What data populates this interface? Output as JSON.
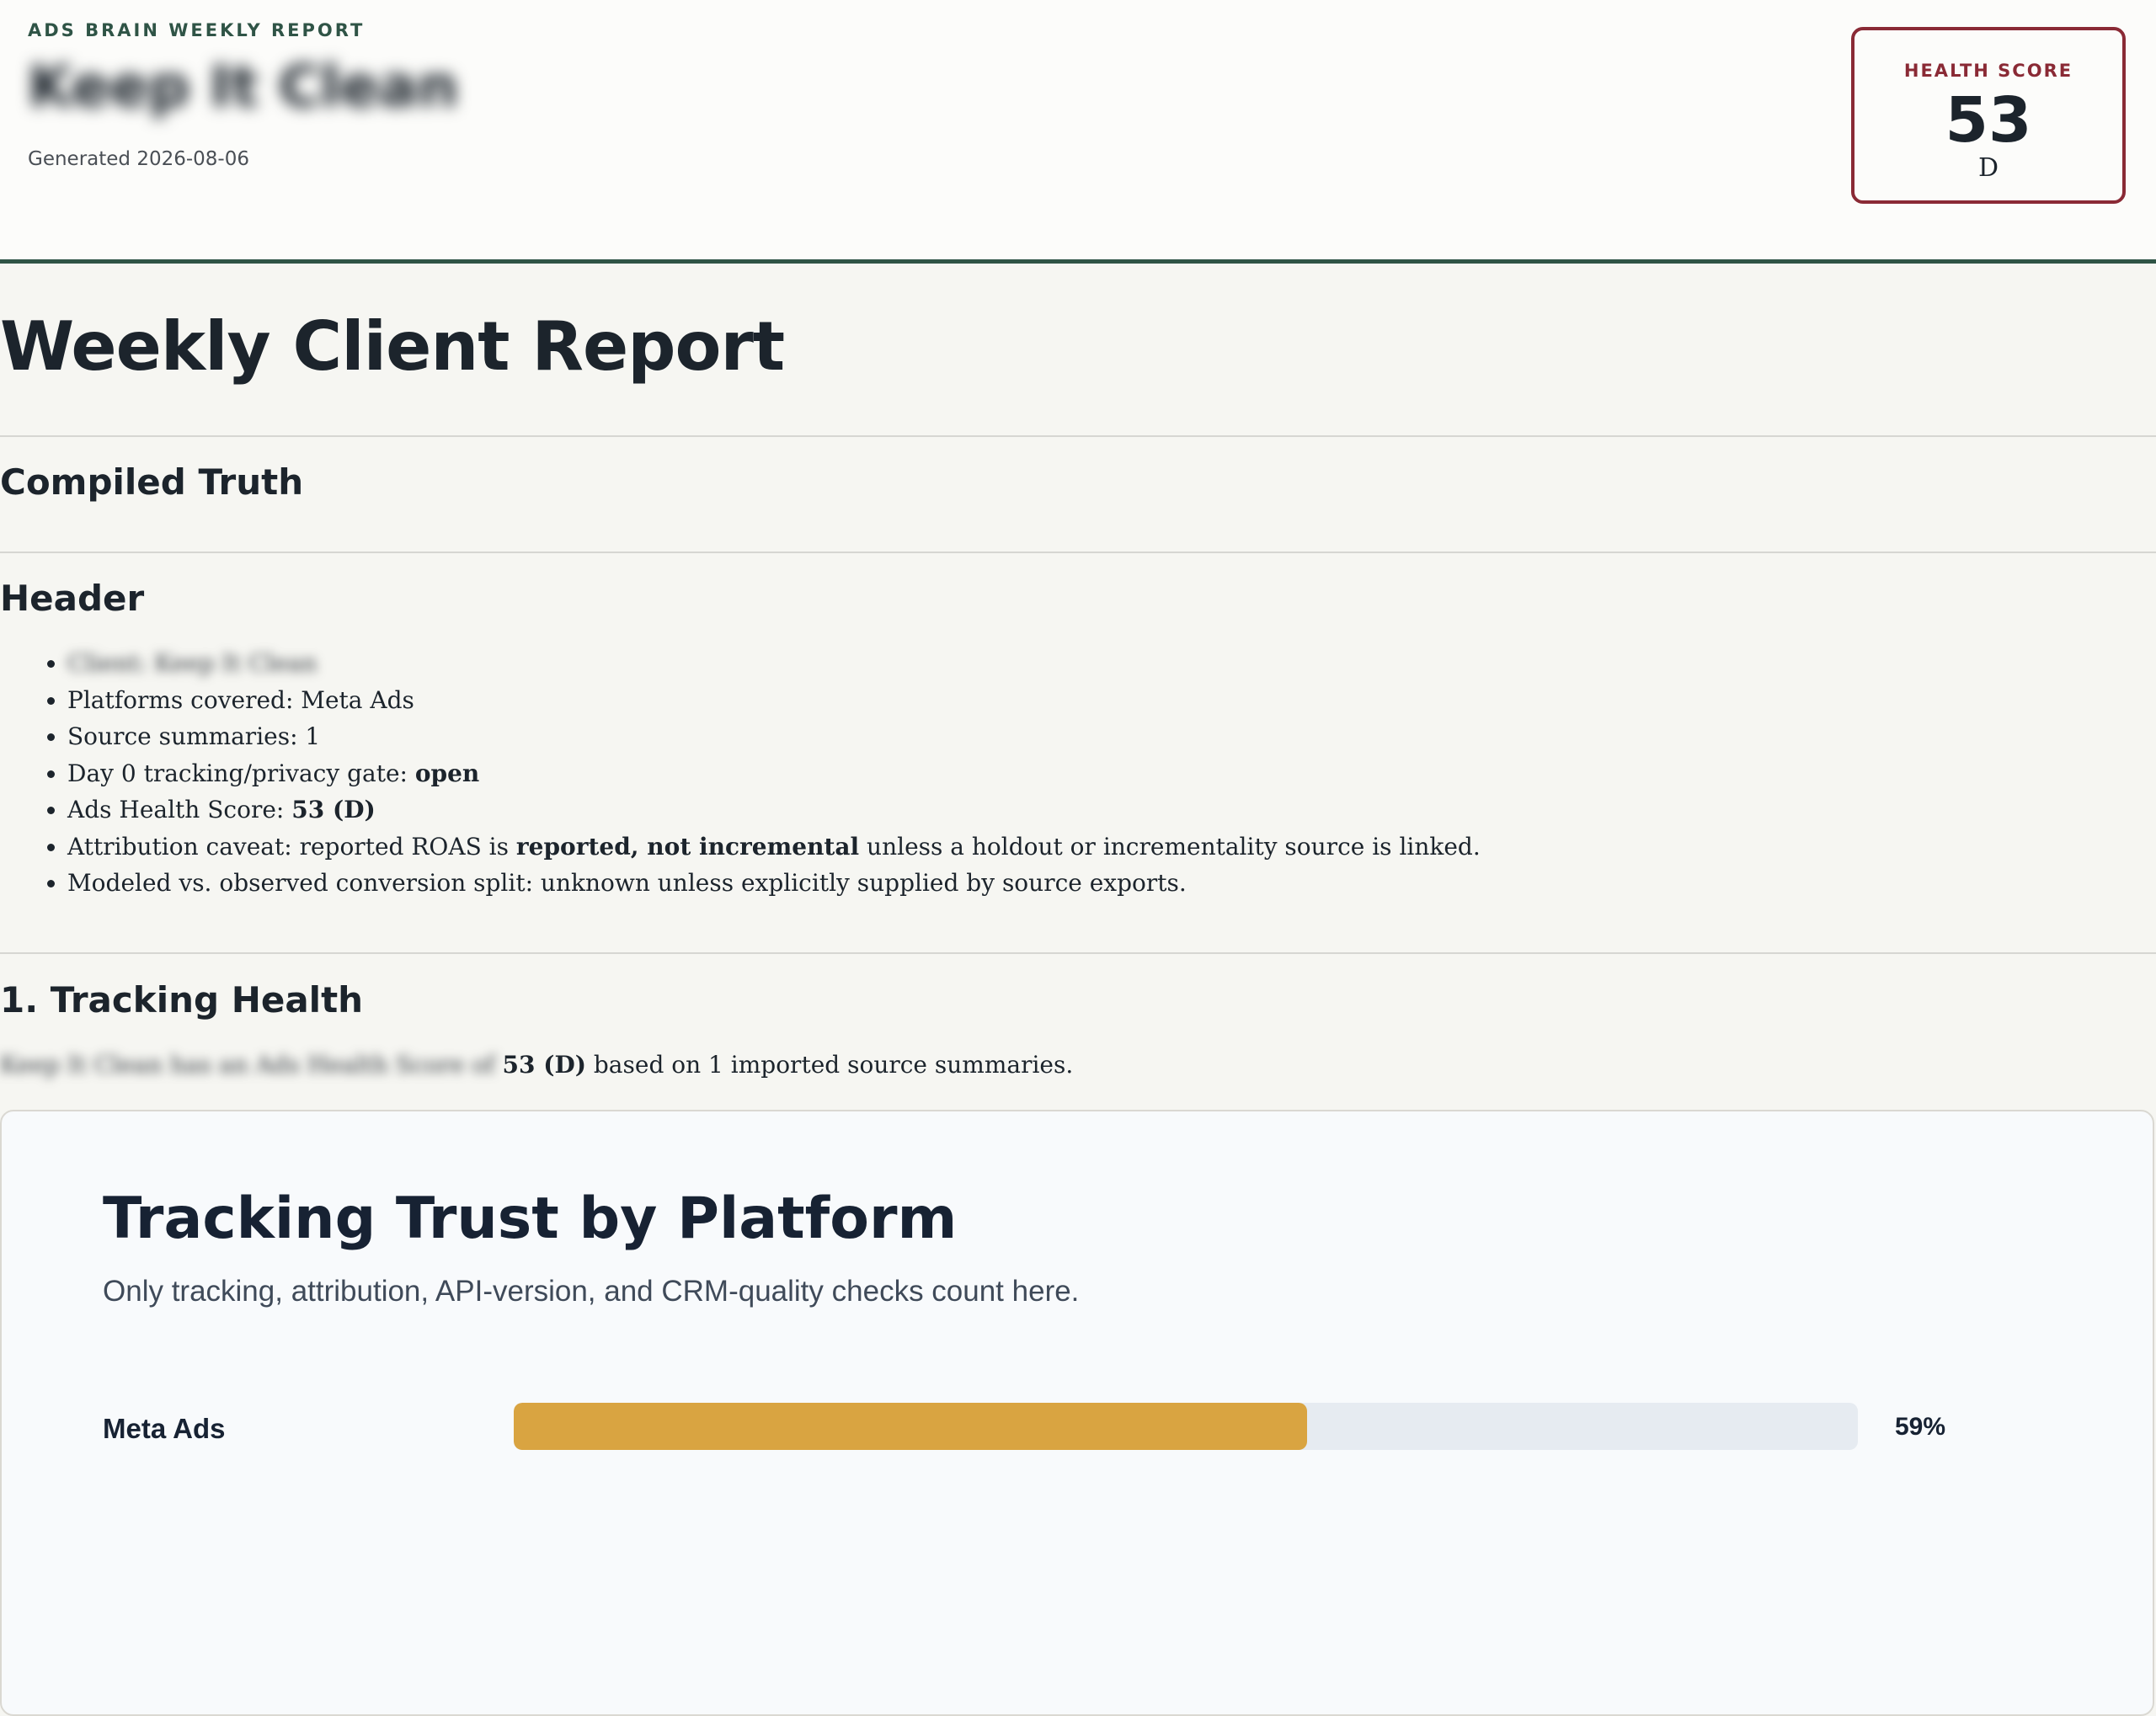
{
  "header": {
    "eyebrow": "ADS BRAIN WEEKLY REPORT",
    "client_name": "Keep It Clean",
    "generated": "Generated 2026-08-06"
  },
  "health_card": {
    "label": "HEALTH SCORE",
    "score": "53",
    "grade": "D"
  },
  "report": {
    "title": "Weekly Client Report",
    "compiled_truth_heading": "Compiled Truth",
    "header_heading": "Header",
    "header_items": {
      "client": "Client: Keep It Clean",
      "platforms": "Platforms covered: Meta Ads",
      "sources": "Source summaries: 1",
      "gate_prefix": "Day 0 tracking/privacy gate: ",
      "gate_value": "open",
      "health_prefix": "Ads Health Score: ",
      "health_value": "53 (D)",
      "attribution_prefix": "Attribution caveat: reported ROAS is ",
      "attribution_bold": "reported, not incremental",
      "attribution_suffix": " unless a holdout or incrementality source is linked.",
      "modeled": "Modeled vs. observed conversion split: unknown unless explicitly supplied by source exports."
    },
    "tracking_heading": "1. Tracking Health",
    "tracking_para_blurred": "Keep It Clean has an Ads Health Score of ",
    "tracking_para_bold": "53 (D)",
    "tracking_para_suffix": " based on 1 imported source summaries."
  },
  "trust_panel": {
    "title": "Tracking Trust by Platform",
    "subtitle": "Only tracking, attribution, API-version, and CRM-quality checks count here.",
    "rows": [
      {
        "platform": "Meta Ads",
        "percent": 59,
        "percent_label": "59%",
        "color": "#d9a441"
      }
    ]
  },
  "colors": {
    "accent_green": "#2f5446",
    "score_border": "#8a2a35",
    "bar_fill": "#d9a441",
    "bar_track": "#e6ebf1"
  }
}
